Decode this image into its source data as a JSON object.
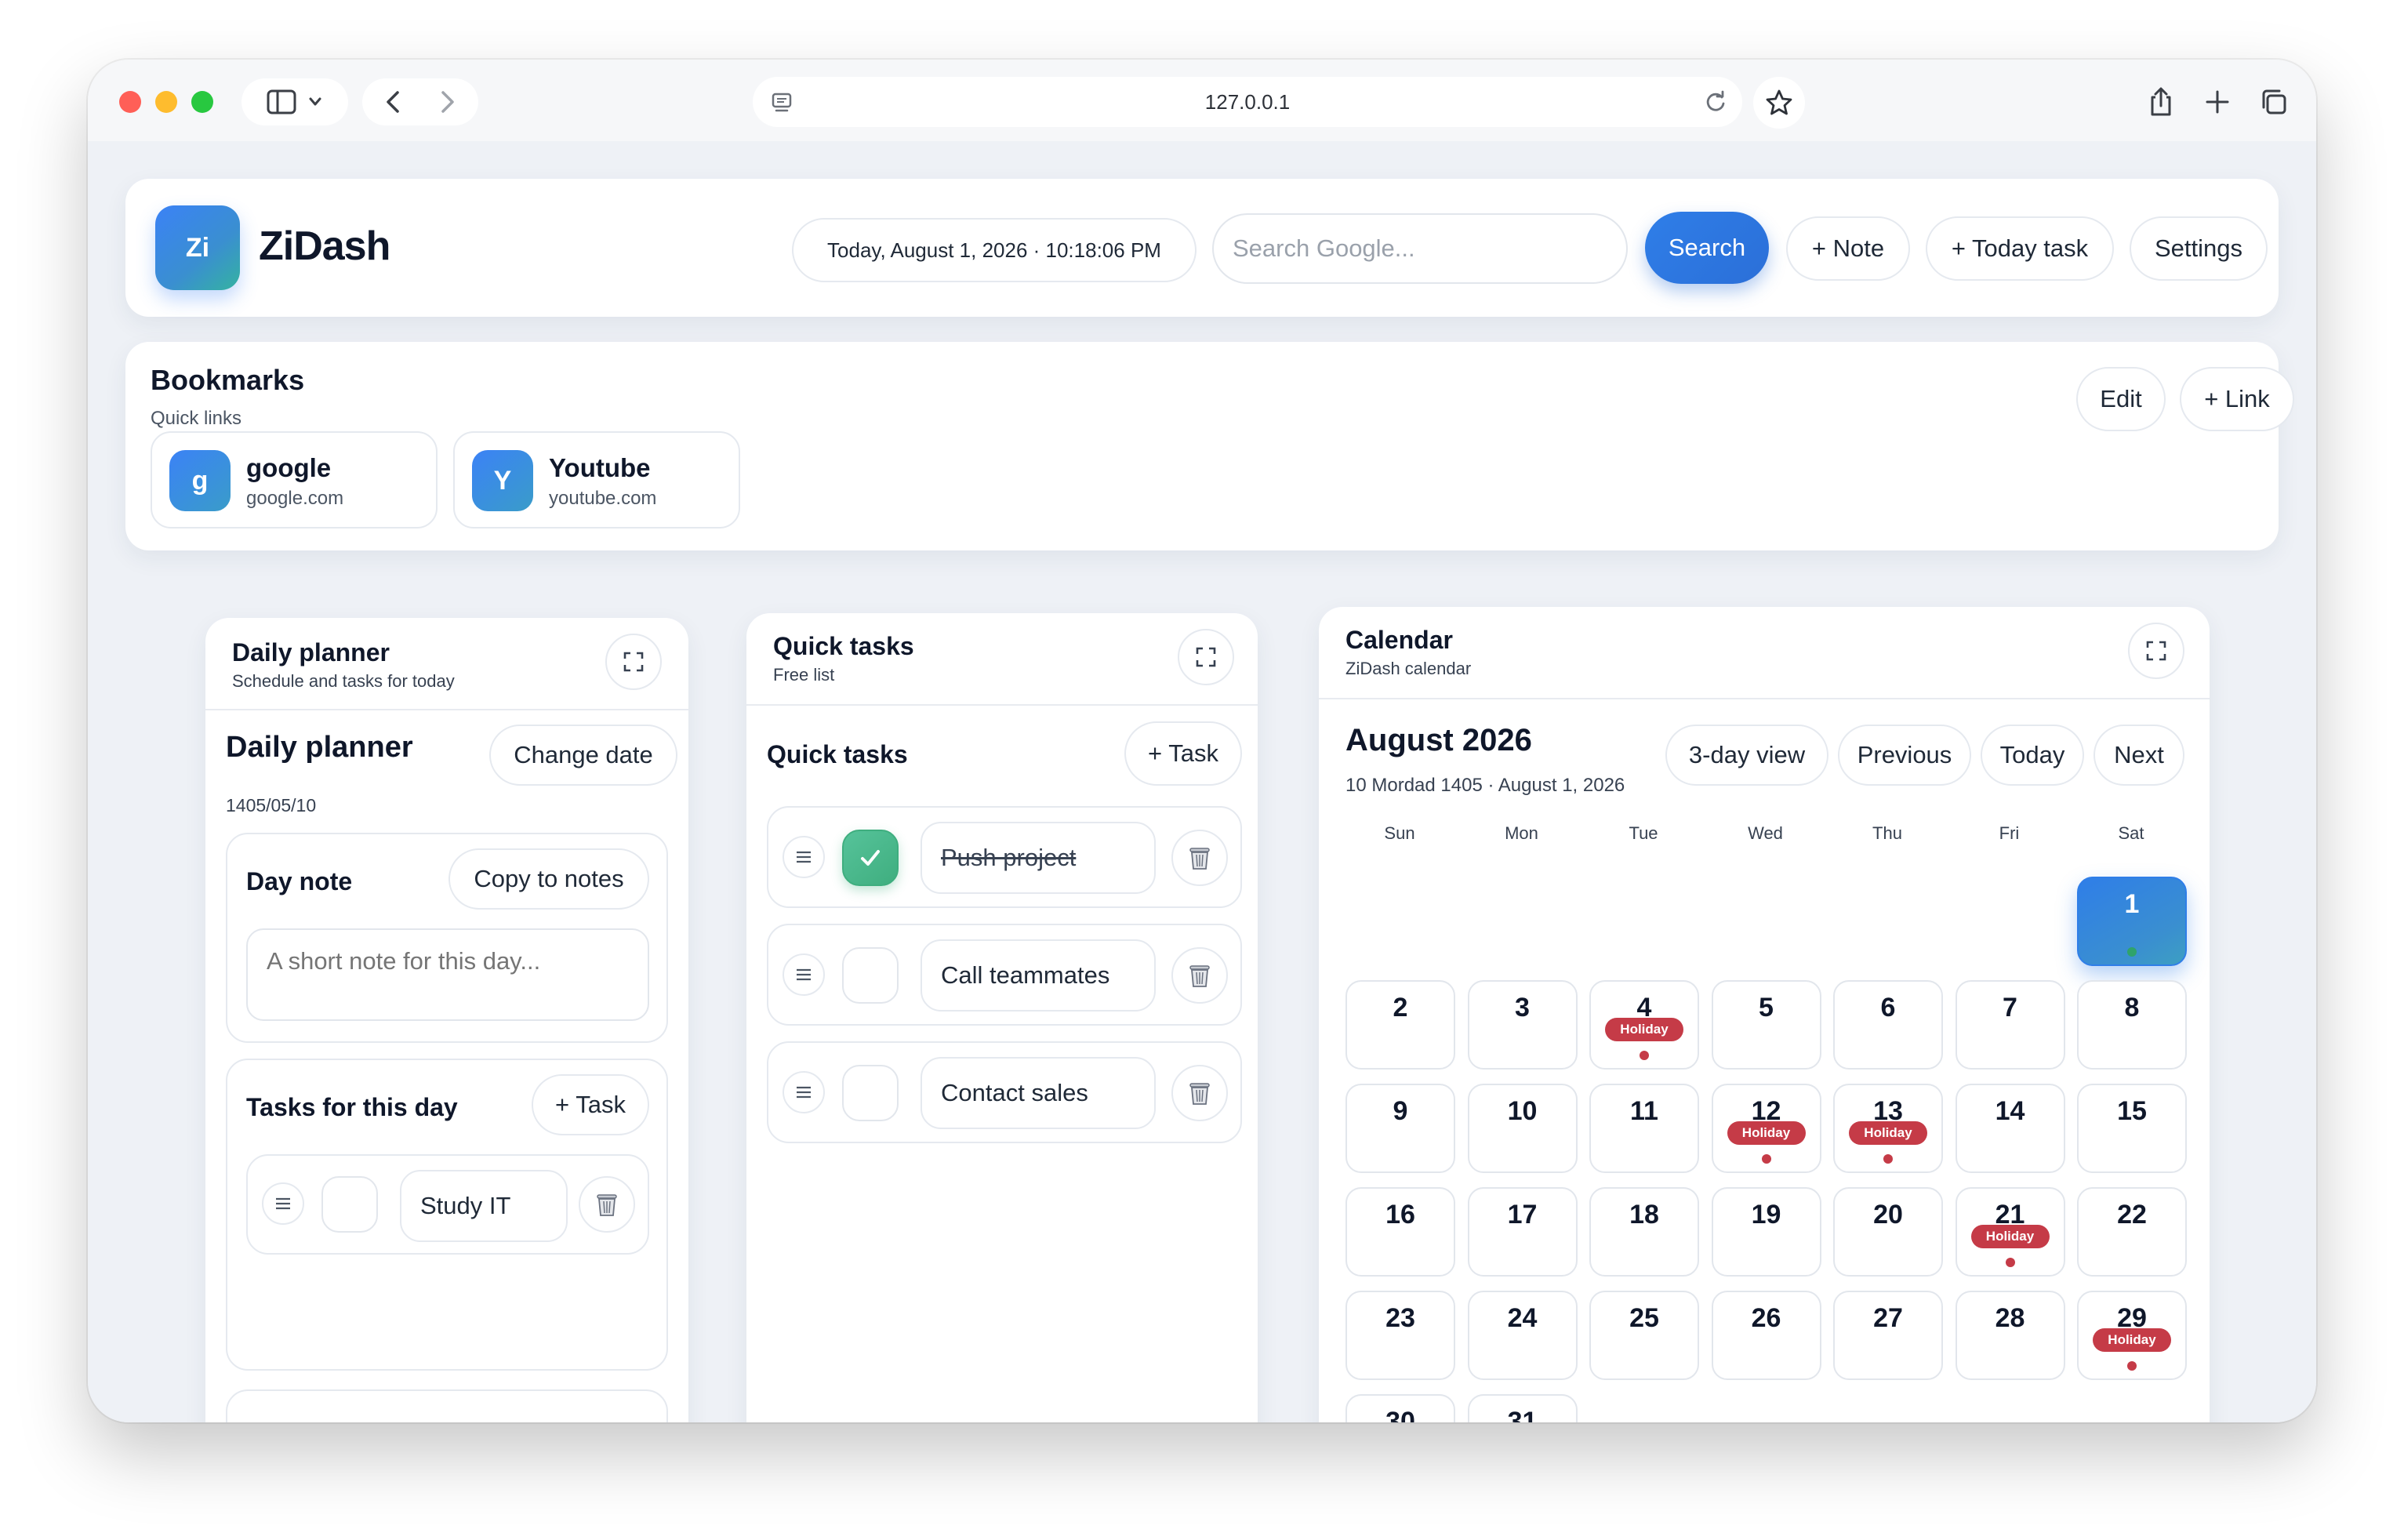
{
  "browser": {
    "url": "127.0.0.1"
  },
  "header": {
    "logo_text": "Zi",
    "brand": "ZiDash",
    "datetime": "Today, August 1, 2026 · 10:18:06 PM",
    "search_placeholder": "Search Google...",
    "search_label": "Search",
    "note_label": "+ Note",
    "today_task_label": "+ Today task",
    "settings_label": "Settings"
  },
  "bookmarks": {
    "title": "Bookmarks",
    "subtitle": "Quick links",
    "edit_label": "Edit",
    "add_link_label": "+ Link",
    "items": [
      {
        "initial": "g",
        "name": "google",
        "domain": "google.com"
      },
      {
        "initial": "Y",
        "name": "Youtube",
        "domain": "youtube.com"
      }
    ]
  },
  "planner": {
    "title": "Daily planner",
    "subtitle": "Schedule and tasks for today",
    "heading": "Daily planner",
    "change_date_label": "Change date",
    "date": "1405/05/10",
    "day_note_title": "Day note",
    "copy_to_notes_label": "Copy to notes",
    "note_placeholder": "A short note for this day...",
    "tasks_title": "Tasks for this day",
    "add_task_label": "+ Task",
    "tasks": [
      {
        "text": "Study IT",
        "done": false
      }
    ]
  },
  "quick_tasks": {
    "title": "Quick tasks",
    "subtitle": "Free list",
    "heading": "Quick tasks",
    "add_task_label": "+ Task",
    "tasks": [
      {
        "text": "Push project",
        "done": true
      },
      {
        "text": "Call teammates",
        "done": false
      },
      {
        "text": "Contact sales",
        "done": false
      }
    ]
  },
  "calendar": {
    "title": "Calendar",
    "subtitle": "ZiDash calendar",
    "month": "August 2026",
    "date_line": "10 Mordad 1405 · August 1, 2026",
    "three_day_label": "3-day view",
    "previous_label": "Previous",
    "today_label": "Today",
    "next_label": "Next",
    "weekdays": [
      "Sun",
      "Mon",
      "Tue",
      "Wed",
      "Thu",
      "Fri",
      "Sat"
    ],
    "first_weekday_index": 6,
    "days_in_month": 31,
    "today": 1,
    "holiday_label": "Holiday",
    "holidays": [
      4,
      12,
      13,
      21,
      29
    ],
    "colors": {
      "accent": "#2f7ee8",
      "holiday": "#c53b47",
      "done": "#3fae7f"
    }
  }
}
